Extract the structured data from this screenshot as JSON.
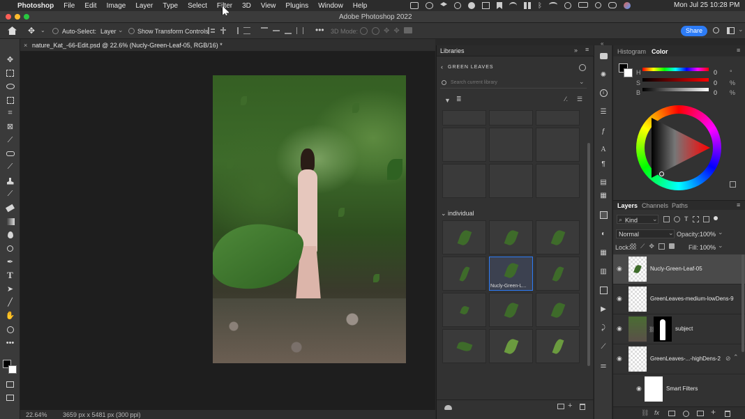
{
  "menubar": {
    "app": "Photoshop",
    "items": [
      "File",
      "Edit",
      "Image",
      "Layer",
      "Type",
      "Select",
      "Filter",
      "3D",
      "View",
      "Plugins",
      "Window",
      "Help"
    ],
    "datetime": "Mon Jul 25  10:28 PM"
  },
  "window": {
    "title": "Adobe Photoshop 2022"
  },
  "options": {
    "auto_select_label": "Auto-Select:",
    "auto_select_value": "Layer",
    "transform_label": "Show Transform Controls",
    "mode_3d_label": "3D Mode:",
    "share_label": "Share"
  },
  "document": {
    "tab_title": "nature_Kat_-66-Edit.psd @ 22.6% (Nucly-Green-Leaf-05, RGB/16) *"
  },
  "status": {
    "zoom": "22.64%",
    "info": "3659 px x 5481 px (300 ppi)"
  },
  "libraries": {
    "panel_title": "Libraries",
    "library_name": "GREEN LEAVES",
    "search_placeholder": "Search current library",
    "section_individual": "individual",
    "selected_item_label": "Nucly-Green-L..."
  },
  "histogram_tab": "Histogram",
  "color_tab": "Color",
  "color": {
    "h_label": "H",
    "h_value": "0",
    "h_unit": "°",
    "s_label": "S",
    "s_value": "0",
    "s_unit": "%",
    "b_label": "B",
    "b_value": "0",
    "b_unit": "%"
  },
  "layers_panel": {
    "tabs": [
      "Layers",
      "Channels",
      "Paths"
    ],
    "filter_kind": "Kind",
    "blend_mode": "Normal",
    "opacity_label": "Opacity:",
    "opacity_value": "100%",
    "lock_label": "Lock:",
    "fill_label": "Fill:",
    "fill_value": "100%",
    "layers": [
      {
        "name": "Nucly-Green-Leaf-05"
      },
      {
        "name": "GreenLeaves-medium-lowDens-9"
      },
      {
        "name": "subject"
      },
      {
        "name": "GreenLeaves-...-highDens-2"
      },
      {
        "name": "Smart Filters"
      }
    ]
  },
  "colors": {
    "accent": "#2d7cf6",
    "panel": "#323232",
    "selected": "#4a4a4a"
  }
}
